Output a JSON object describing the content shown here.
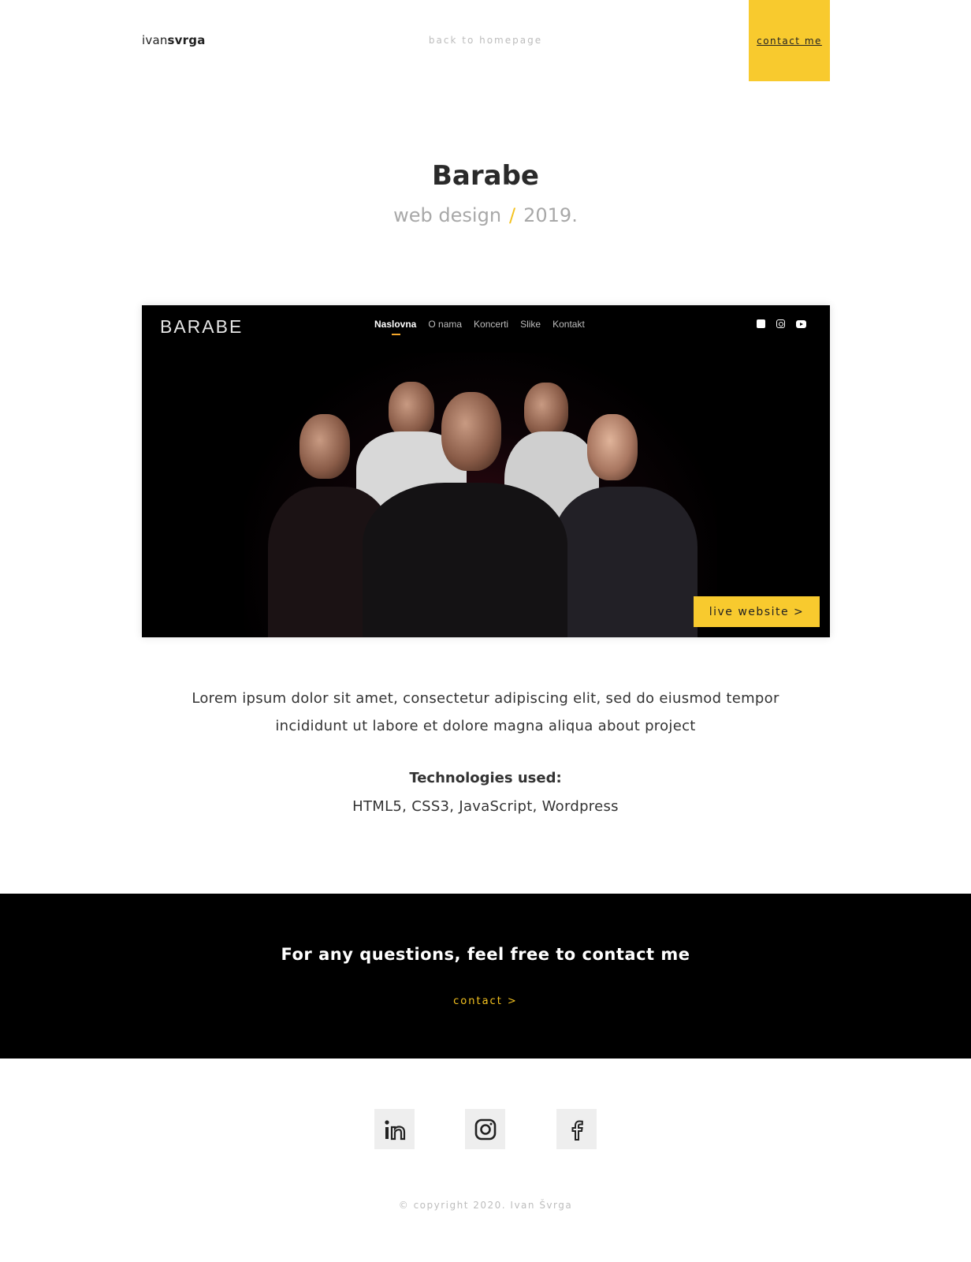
{
  "header": {
    "logo_regular": "ivan",
    "logo_bold": "svrga",
    "back_link": "back to homepage",
    "contact_button": "contact me"
  },
  "project": {
    "title": "Barabe",
    "category": "web design",
    "separator": "/",
    "year": "2019."
  },
  "preview": {
    "site_logo": "BARABE",
    "nav": [
      "Naslovna",
      "O nama",
      "Koncerti",
      "Slike",
      "Kontakt"
    ],
    "social_icons": [
      "facebook-icon",
      "instagram-icon",
      "youtube-icon"
    ],
    "live_button": "live website >"
  },
  "description": "Lorem ipsum dolor sit amet, consectetur adipiscing elit, sed do eiusmod tempor incididunt ut labore et dolore magna aliqua about project",
  "technologies": {
    "label": "Technologies used:",
    "list": "HTML5, CSS3, JavaScript, Wordpress"
  },
  "contact_band": {
    "title": "For any questions, feel free to contact me",
    "link": "contact >"
  },
  "socials": [
    "linkedin-icon",
    "instagram-icon",
    "facebook-icon"
  ],
  "footer": {
    "copyright": "© copyright 2020. Ivan Švrga"
  },
  "colors": {
    "accent": "#f8ca2e",
    "dark": "#000000",
    "muted": "#bdbdbd"
  }
}
